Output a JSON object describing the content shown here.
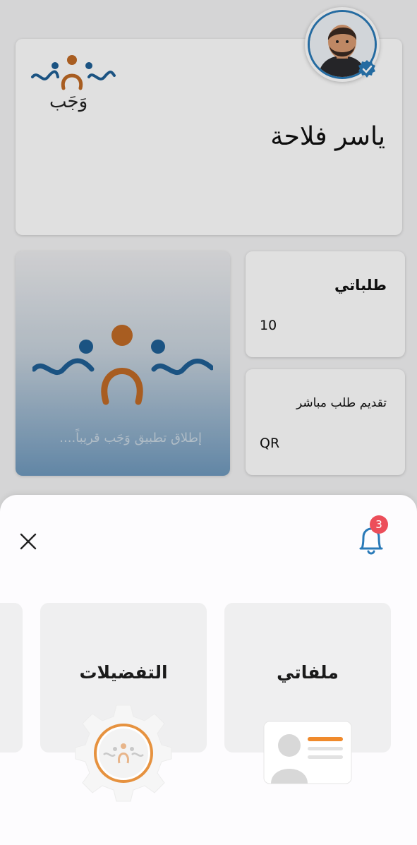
{
  "profile": {
    "brand_word": "وَجَب",
    "user_name": "ياسر فلاحة"
  },
  "tiles": {
    "requests": {
      "title": "طلباتي",
      "value": "10"
    },
    "direct": {
      "title": "تقديم طلب مباشر",
      "value": "QR"
    }
  },
  "banner": {
    "text": "إطلاق تطبيق وَجَب قريباً...."
  },
  "sheet": {
    "notification_count": "3",
    "menu": [
      {
        "label": "ملفاتي",
        "icon": "id-card-icon"
      },
      {
        "label": "التفضيلات",
        "icon": "gear-icon"
      }
    ]
  },
  "colors": {
    "brand_blue": "#1f5f95",
    "brand_orange": "#c06a26",
    "badge_red": "#ec4e5a",
    "verified_blue": "#2a7ab8"
  }
}
